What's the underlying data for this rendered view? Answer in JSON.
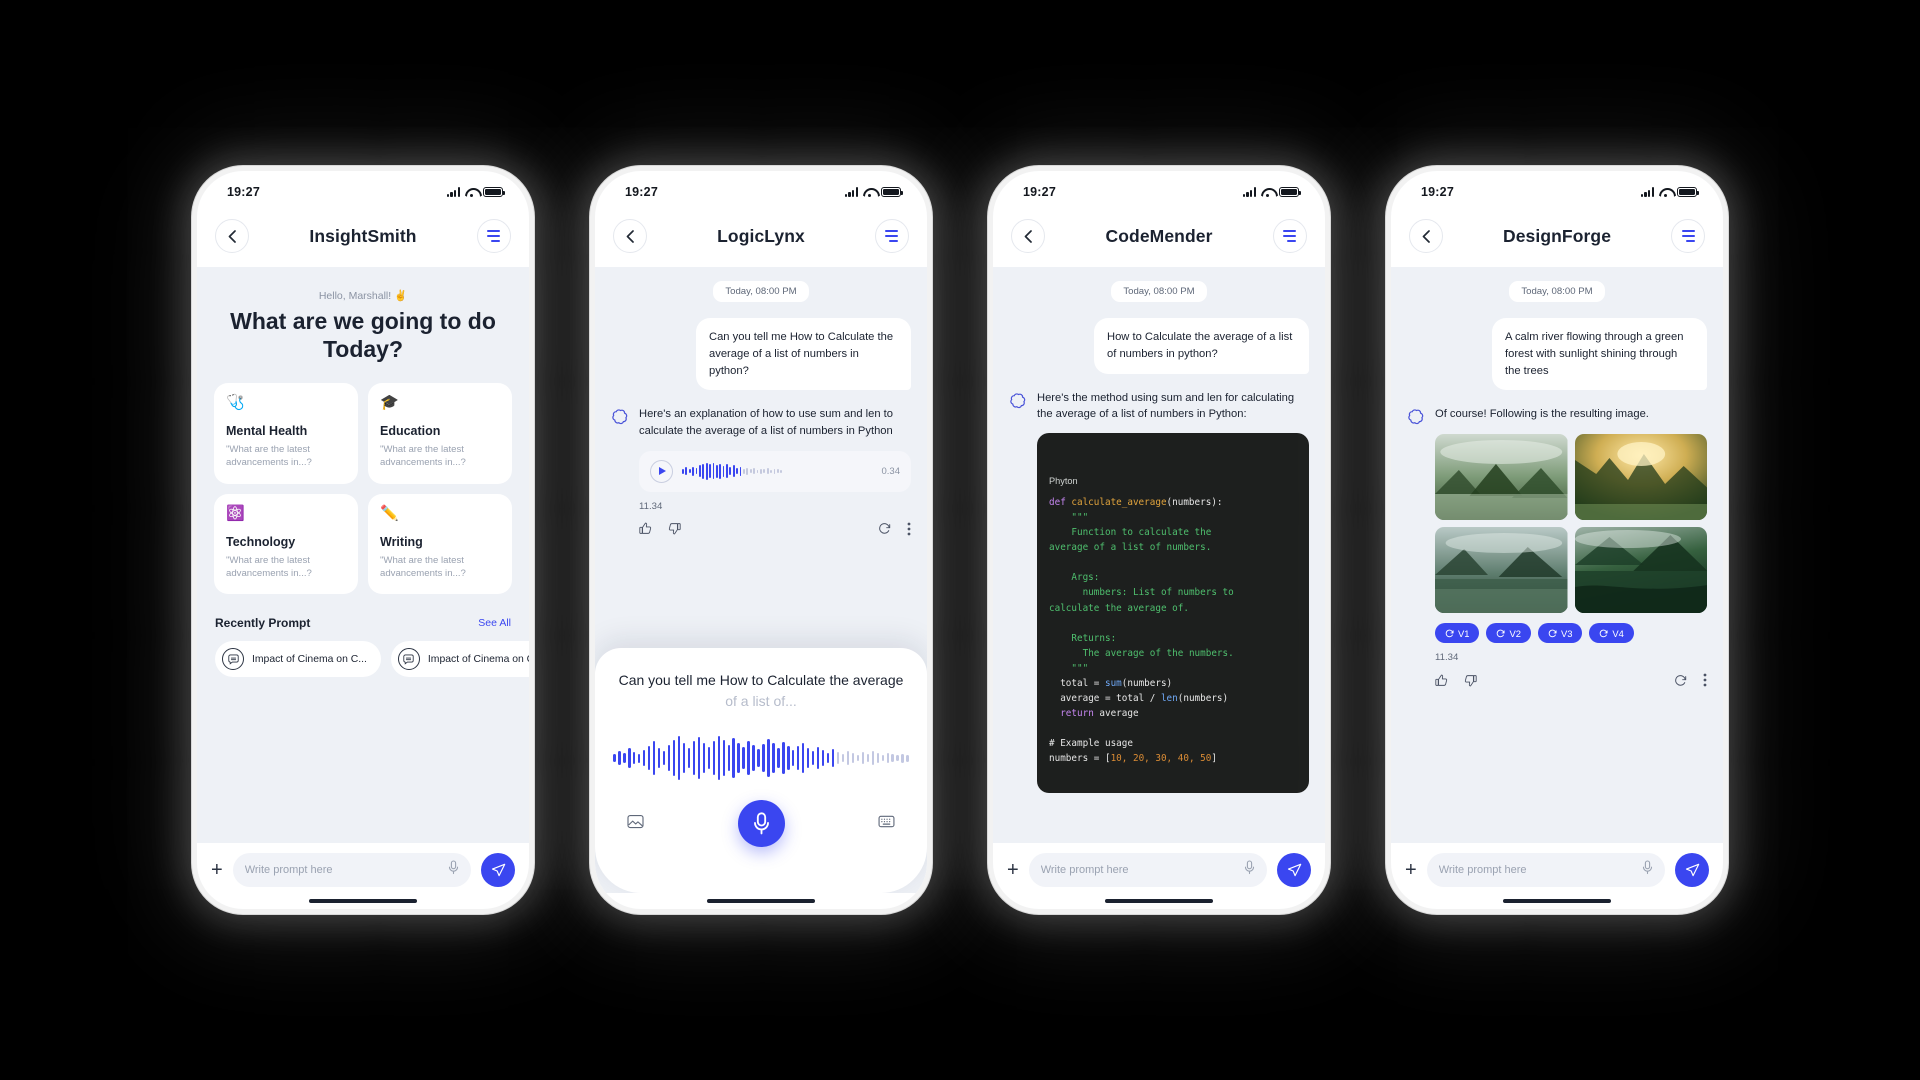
{
  "status": {
    "time": "19:27",
    "signal_icon": "cellular-signal-icon",
    "wifi_icon": "wifi-icon",
    "battery_icon": "battery-icon"
  },
  "common": {
    "back_icon": "chevron-left-icon",
    "menu_icon": "hamburger-menu-icon",
    "composer_placeholder": "Write prompt here",
    "plus_label": "+",
    "mic_icon": "microphone-icon",
    "send_icon": "send-icon",
    "accent": "#3a46f0",
    "bg": "#eef1f6",
    "day_label": "Today, 08:00 PM"
  },
  "screens": [
    {
      "id": "home",
      "title": "InsightSmith",
      "greeting": "Hello, Marshall! ✌️",
      "headline": "What are we going to do Today?",
      "cards": [
        {
          "icon": "stethoscope-icon",
          "glyph": "🩺",
          "title": "Mental Health",
          "subtitle": "\"What are the latest advancements in...?"
        },
        {
          "icon": "graduation-cap-icon",
          "glyph": "🎓",
          "title": "Education",
          "subtitle": "\"What are the latest advancements in...?"
        },
        {
          "icon": "atom-icon",
          "glyph": "⚛️",
          "title": "Technology",
          "subtitle": "\"What are the latest advancements in...?"
        },
        {
          "icon": "pencil-icon",
          "glyph": "✏️",
          "title": "Writing",
          "subtitle": "\"What are the latest advancements in...?"
        }
      ],
      "recent_title": "Recently Prompt",
      "see_all": "See All",
      "chips": [
        {
          "icon": "chat-bubble-icon",
          "label": "Impact of Cinema on C..."
        },
        {
          "icon": "chat-bubble-icon",
          "label": "Impact of Cinema on C..."
        }
      ]
    },
    {
      "id": "voice",
      "title": "LogicLynx",
      "user_message": "Can you tell me How to Calculate the average of a list of numbers in python?",
      "bot_message": "Here's an explanation of how to use sum and len to calculate the average of a list of numbers in Python",
      "audio_duration": "0.34",
      "message_time": "11.34",
      "actions": {
        "like_icon": "thumbs-up-icon",
        "dislike_icon": "thumbs-down-icon",
        "regenerate_icon": "refresh-icon",
        "more_icon": "more-vertical-icon"
      },
      "voice_panel": {
        "transcript_spoken": "Can you tell me How to Calculate the average ",
        "transcript_pending": "of a list of...",
        "left_icon": "image-attach-icon",
        "right_icon": "keyboard-icon",
        "mic_icon": "microphone-icon"
      }
    },
    {
      "id": "code",
      "title": "CodeMender",
      "user_message": "How to Calculate the average of a list of numbers in python?",
      "bot_message": "Here's the method using sum and len for calculating the average of a list of numbers in Python:",
      "code": {
        "language": "Phyton",
        "lines": [
          {
            "t": "def ",
            "c": "k"
          },
          {
            "t": "calculate_average",
            "c": "fn"
          },
          {
            "t": "(numbers):\n",
            "c": ""
          },
          {
            "t": "    \"\"\"\n    Function to calculate the\naverage of a list of numbers.\n\n    Args:\n      numbers: List of numbers to\ncalculate the average of.\n\n    Returns:\n      The average of the numbers.\n    \"\"\"\n",
            "c": "cm"
          },
          {
            "t": "  total = ",
            "c": ""
          },
          {
            "t": "sum",
            "c": "bi"
          },
          {
            "t": "(numbers)\n",
            "c": ""
          },
          {
            "t": "  average = total / ",
            "c": ""
          },
          {
            "t": "len",
            "c": "bi"
          },
          {
            "t": "(numbers)\n",
            "c": ""
          },
          {
            "t": "  return",
            "c": "k"
          },
          {
            "t": " average\n\n",
            "c": ""
          },
          {
            "t": "# Example usage\n",
            "c": ""
          },
          {
            "t": "numbers = [",
            "c": ""
          },
          {
            "t": "10, 20, 30, 40, 50",
            "c": "num"
          },
          {
            "t": "]",
            "c": ""
          }
        ]
      }
    },
    {
      "id": "image",
      "title": "DesignForge",
      "user_message": "A calm river flowing through a green forest with sunlight shining through the trees",
      "bot_message": "Of course! Following is the resulting image.",
      "message_time": "11.34",
      "variants": [
        {
          "label": "V1",
          "icon": "refresh-icon"
        },
        {
          "label": "V2",
          "icon": "refresh-icon"
        },
        {
          "label": "V3",
          "icon": "refresh-icon"
        },
        {
          "label": "V4",
          "icon": "refresh-icon"
        }
      ],
      "actions": {
        "like_icon": "thumbs-up-icon",
        "dislike_icon": "thumbs-down-icon",
        "regenerate_icon": "refresh-icon",
        "more_icon": "more-vertical-icon"
      }
    }
  ]
}
